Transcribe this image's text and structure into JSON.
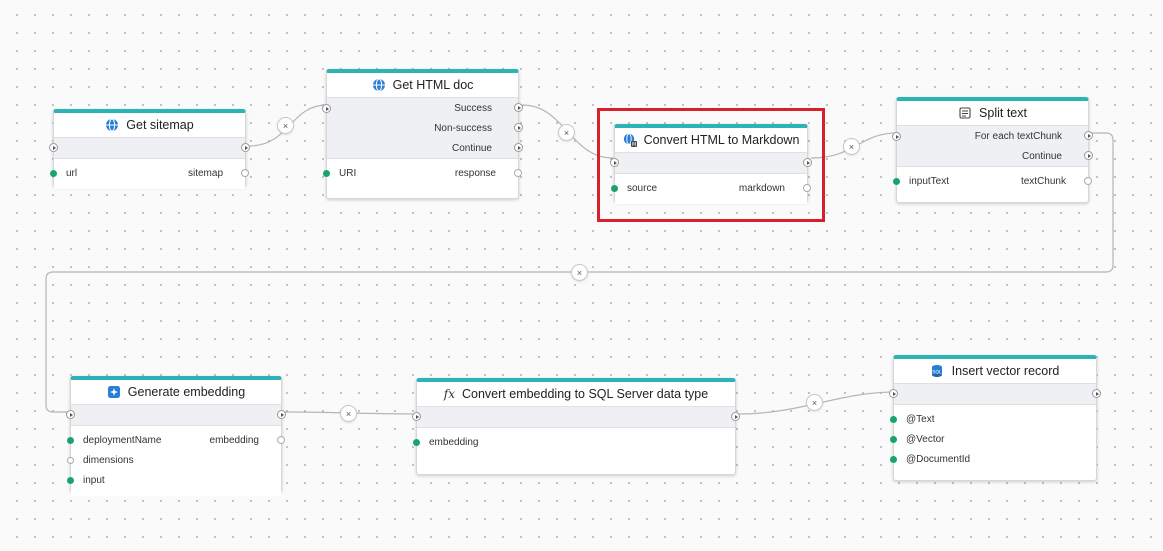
{
  "nodes": {
    "get_sitemap": {
      "title": "Get sitemap",
      "icon": "globe-icon",
      "inputs": [
        "url"
      ],
      "outputs": [
        "sitemap"
      ]
    },
    "get_html_doc": {
      "title": "Get HTML doc",
      "icon": "globe-icon",
      "flow_outputs": [
        "Success",
        "Non-success",
        "Continue"
      ],
      "inputs": [
        "URI"
      ],
      "outputs": [
        "response"
      ]
    },
    "convert_html": {
      "title": "Convert HTML to Markdown",
      "icon": "convert-globe-icon",
      "inputs": [
        "source"
      ],
      "outputs": [
        "markdown"
      ]
    },
    "split_text": {
      "title": "Split text",
      "icon": "document-icon",
      "flow_outputs": [
        "For each textChunk",
        "Continue"
      ],
      "inputs": [
        "inputText"
      ],
      "outputs": [
        "textChunk"
      ]
    },
    "generate_embedding": {
      "title": "Generate embedding",
      "icon": "ai-sparkle-icon",
      "inputs": [
        "deploymentName",
        "dimensions",
        "input"
      ],
      "outputs": [
        "embedding"
      ]
    },
    "convert_embedding": {
      "title": "Convert embedding to SQL Server data type",
      "icon": "fx-icon",
      "icon_text": "fx",
      "inputs": [
        "embedding"
      ]
    },
    "insert_vector": {
      "title": "Insert vector record",
      "icon": "sql-database-icon",
      "inputs": [
        "@Text",
        "@Vector",
        "@DocumentId"
      ]
    }
  },
  "connection_delete_glyph": "×",
  "colors": {
    "accent": "#2bb3b6",
    "port_connected": "#1ca36b",
    "highlight": "#d9202a",
    "wire": "#b5b5b5"
  }
}
